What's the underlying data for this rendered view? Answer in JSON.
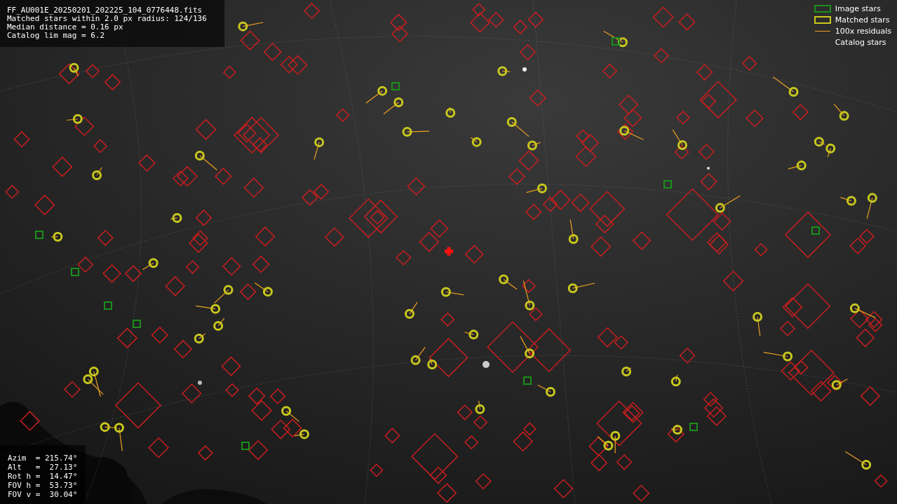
{
  "info": {
    "lines": [
      "FF_AU001E_20250201_202225_104_0776448.fits",
      "Matched stars within 2.0 px radius: 124/136",
      "Median distance = 0.16 px",
      "Catalog lim mag = 6.2"
    ]
  },
  "legend": [
    {
      "kind": "square",
      "label": "Image stars",
      "color": "#1a8f1a"
    },
    {
      "kind": "square",
      "label": "Matched stars",
      "color": "#c8c81e"
    },
    {
      "kind": "line",
      "label": "100x residuals",
      "color": "#f0a020"
    },
    {
      "kind": "none",
      "label": "Catalog stars"
    }
  ],
  "pointing": {
    "lines": [
      "Azim  = 215.74°",
      "Alt   =  27.13°",
      "Rot h =  14.47°",
      "FOV h =  53.73°",
      "FOV v =  30.04°"
    ]
  }
}
